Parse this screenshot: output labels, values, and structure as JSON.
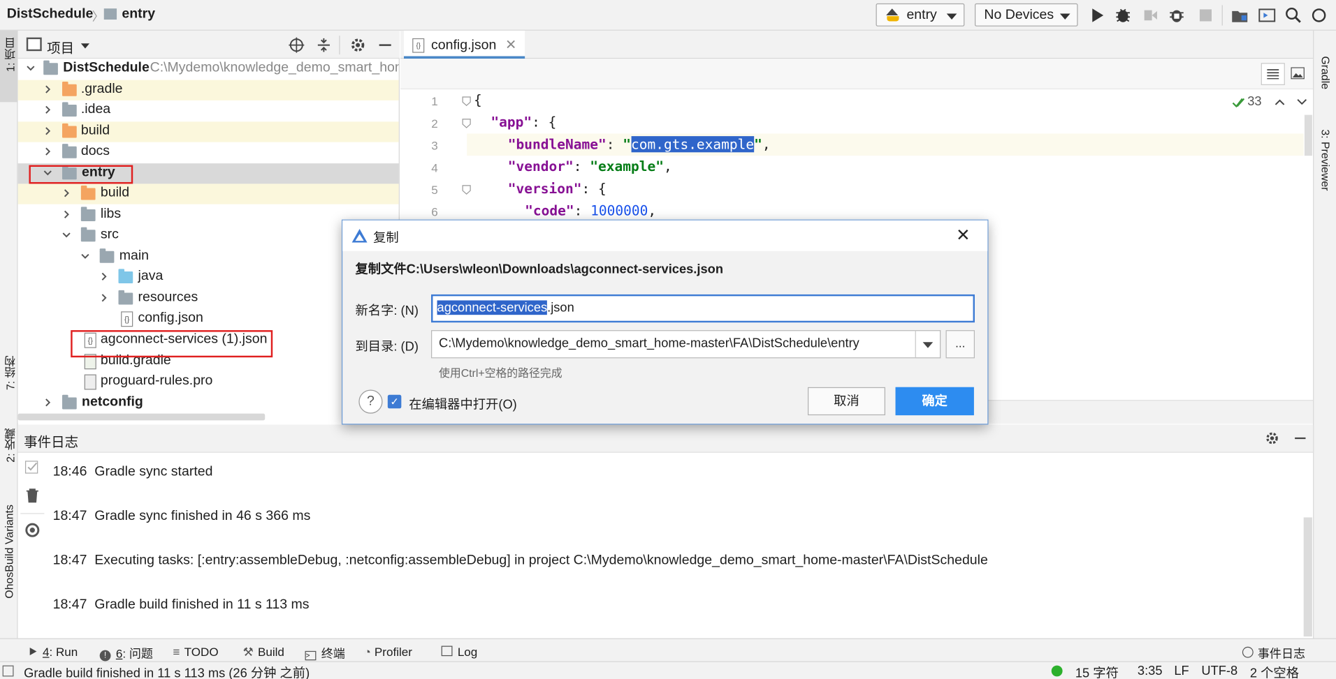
{
  "topbar": {
    "project": "DistSchedule",
    "module": "entry",
    "run_config": "entry",
    "device": "No Devices"
  },
  "left_strip": {
    "project_tab": "1: 项目",
    "structure_tab": "7: 结构",
    "favorites_tab": "2: 收藏",
    "build_variants_tab": "OhosBuild Variants"
  },
  "right_strip": {
    "gradle_tab": "Gradle",
    "previewer_tab": "3: Previewer"
  },
  "project_panel": {
    "title": "项目",
    "root_name": "DistSchedule",
    "root_path": "C:\\Mydemo\\knowledge_demo_smart_home-master\\FA\\DistSchedule",
    "items": [
      {
        "label": ".gradle"
      },
      {
        "label": ".idea"
      },
      {
        "label": "build"
      },
      {
        "label": "docs"
      },
      {
        "label": "entry"
      },
      {
        "label": "build"
      },
      {
        "label": "libs"
      },
      {
        "label": "src"
      },
      {
        "label": "main"
      },
      {
        "label": "java"
      },
      {
        "label": "resources"
      },
      {
        "label": "config.json"
      },
      {
        "label": "agconnect-services (1).json"
      },
      {
        "label": "build.gradle"
      },
      {
        "label": "proguard-rules.pro"
      },
      {
        "label": "netconfig"
      }
    ]
  },
  "editor": {
    "tab": "config.json",
    "inspection_count": "33",
    "line_numbers": [
      "1",
      "2",
      "3",
      "4",
      "5",
      "6"
    ],
    "lines": {
      "l1": "{",
      "l2_key": "\"app\"",
      "l2_rest": ": {",
      "l3_key": "\"bundleName\"",
      "l3_colon": ": ",
      "l3_q1": "\"",
      "l3_sel": "com.gts.example",
      "l3_q2": "\"",
      "l3_end": ",",
      "l4_key": "\"vendor\"",
      "l4_colon": ": ",
      "l4_val": "\"example\"",
      "l4_end": ",",
      "l5_key": "\"version\"",
      "l5_rest": ": {",
      "l6_key": "\"code\"",
      "l6_colon": ": ",
      "l6_val": "1000000",
      "l6_end": ","
    }
  },
  "dialog": {
    "title": "复制",
    "heading": "复制文件C:\\Users\\wleon\\Downloads\\agconnect-services.json",
    "name_label": "新名字: (N)",
    "name_selected": "agconnect-services",
    "name_rest": ".json",
    "dir_label": "到目录: (D)",
    "dir_value": "C:\\Mydemo\\knowledge_demo_smart_home-master\\FA\\DistSchedule\\entry",
    "browse": "...",
    "hint": "使用Ctrl+空格的路径完成",
    "open_in_editor": "在编辑器中打开(O)",
    "open_in_editor_checked": true,
    "cancel": "取消",
    "ok": "确定"
  },
  "event_log": {
    "title": "事件日志",
    "entries": [
      {
        "time": "18:46",
        "text": "Gradle sync started"
      },
      {
        "time": "18:47",
        "text": "Gradle sync finished in 46 s 366 ms"
      },
      {
        "time": "18:47",
        "text": "Executing tasks: [:entry:assembleDebug, :netconfig:assembleDebug] in project C:\\Mydemo\\knowledge_demo_smart_home-master\\FA\\DistSchedule"
      },
      {
        "time": "18:47",
        "text": "Gradle build finished in 11 s 113 ms"
      }
    ]
  },
  "bottom_tabs": {
    "run_num": "4",
    "run": ": Run",
    "problems_num": "6",
    "problems": ": 问题",
    "todo": "TODO",
    "build": "Build",
    "terminal": "终端",
    "profiler": "Profiler",
    "log": "Log",
    "event_log": "事件日志"
  },
  "status_bar": {
    "message": "Gradle build finished in 11 s 113 ms (26 分钟 之前)",
    "chars": "15 字符",
    "position": "3:35",
    "line_sep": "LF",
    "encoding": "UTF-8",
    "indent": "2 个空格"
  },
  "colors": {
    "accent": "#2d8cf0",
    "highlight_box": "#e02020",
    "selection": "#2f65ca"
  }
}
